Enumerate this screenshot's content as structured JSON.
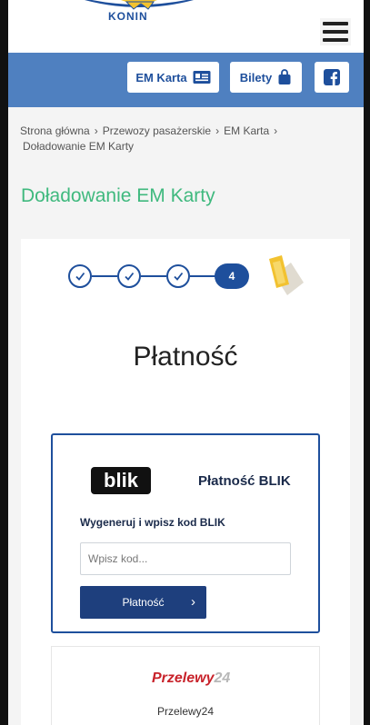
{
  "header": {
    "logo_text": "KONIN",
    "menu_icon": "hamburger-menu-icon"
  },
  "nav": {
    "emkarta_label": "EM Karta",
    "emkarta_icon": "id-card-icon",
    "bilety_label": "Bilety",
    "bilety_icon": "bag-icon",
    "facebook_icon": "facebook-icon"
  },
  "breadcrumb": {
    "items": [
      "Strona główna",
      "Przewozy pasażerskie",
      "EM Karta",
      "Doładowanie EM Karty"
    ],
    "separator": "›"
  },
  "page_title": "Doładowanie EM Karty",
  "steps": {
    "completed": [
      1,
      2,
      3
    ],
    "active_label": "4",
    "ticket_icon": "ticket-icon"
  },
  "payment": {
    "heading": "Płatność",
    "blik": {
      "logo_text": "blik",
      "title": "Płatność BLIK",
      "instruction": "Wygeneruj i wpisz kod BLIK",
      "input_placeholder": "Wpisz kod...",
      "button_label": "Płatność",
      "button_icon": "chevron-right-icon"
    },
    "p24": {
      "logo_text": "Przelewy",
      "logo_number": "24",
      "label": "Przelewy24"
    }
  },
  "colors": {
    "blue_bar": "#4f80c0",
    "primary": "#1e4f9c",
    "button_dark": "#1e3f7d",
    "title_green": "#3fb97e"
  }
}
